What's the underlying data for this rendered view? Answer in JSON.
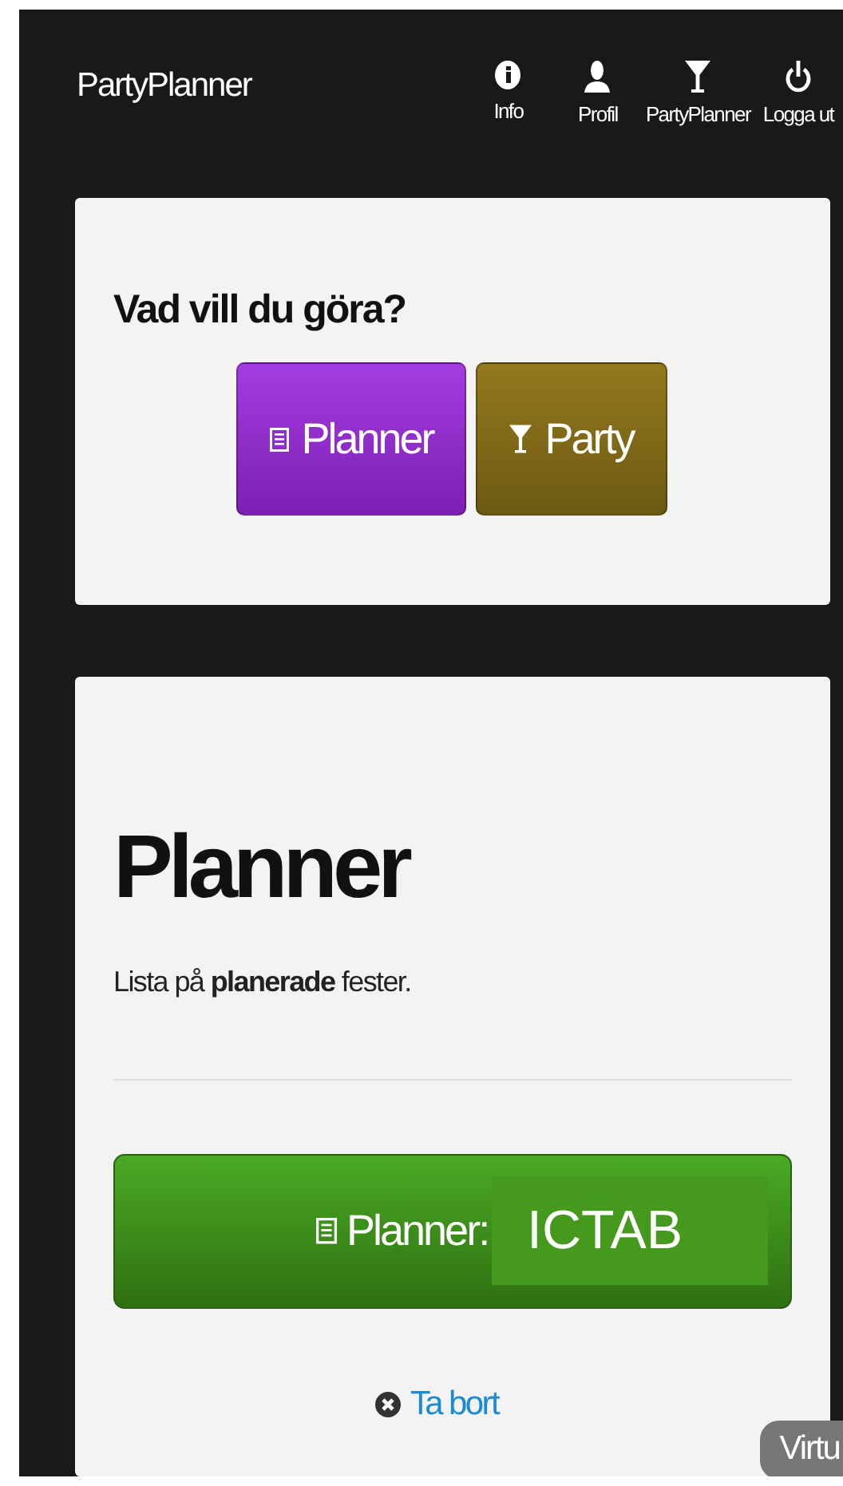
{
  "navbar": {
    "brand": "PartyPlanner",
    "items": [
      {
        "kind": "info",
        "label": "Info"
      },
      {
        "kind": "profile",
        "label": "Profil"
      },
      {
        "kind": "party",
        "label": "PartyPlanner"
      },
      {
        "kind": "logout",
        "label": "Logga ut"
      }
    ]
  },
  "choice_card": {
    "heading": "Vad vill du göra?",
    "buttons": [
      {
        "kind": "planner",
        "label": "Planner"
      },
      {
        "kind": "party",
        "label": "Party"
      }
    ]
  },
  "planner_card": {
    "title": "Planner",
    "description": "Lista på **planerade** fester.",
    "action_button": {
      "label": "Planner:",
      "overlay": "ICTAB"
    },
    "remove_link": "Ta bort"
  },
  "corner_badge": "Virtu"
}
